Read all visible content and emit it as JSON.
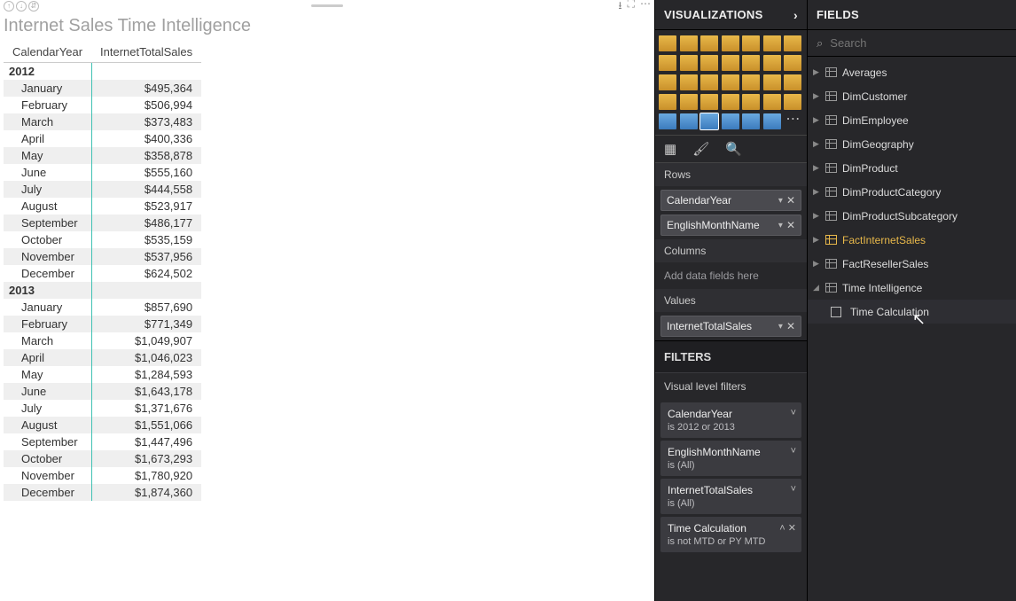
{
  "report": {
    "title": "Internet Sales Time Intelligence",
    "columns": [
      "CalendarYear",
      "InternetTotalSales"
    ],
    "groups": [
      {
        "year": "2012",
        "rows": [
          {
            "month": "January",
            "value": "$495,364"
          },
          {
            "month": "February",
            "value": "$506,994"
          },
          {
            "month": "March",
            "value": "$373,483"
          },
          {
            "month": "April",
            "value": "$400,336"
          },
          {
            "month": "May",
            "value": "$358,878"
          },
          {
            "month": "June",
            "value": "$555,160"
          },
          {
            "month": "July",
            "value": "$444,558"
          },
          {
            "month": "August",
            "value": "$523,917"
          },
          {
            "month": "September",
            "value": "$486,177"
          },
          {
            "month": "October",
            "value": "$535,159"
          },
          {
            "month": "November",
            "value": "$537,956"
          },
          {
            "month": "December",
            "value": "$624,502"
          }
        ]
      },
      {
        "year": "2013",
        "rows": [
          {
            "month": "January",
            "value": "$857,690"
          },
          {
            "month": "February",
            "value": "$771,349"
          },
          {
            "month": "March",
            "value": "$1,049,907"
          },
          {
            "month": "April",
            "value": "$1,046,023"
          },
          {
            "month": "May",
            "value": "$1,284,593"
          },
          {
            "month": "June",
            "value": "$1,643,178"
          },
          {
            "month": "July",
            "value": "$1,371,676"
          },
          {
            "month": "August",
            "value": "$1,551,066"
          },
          {
            "month": "September",
            "value": "$1,447,496"
          },
          {
            "month": "October",
            "value": "$1,673,293"
          },
          {
            "month": "November",
            "value": "$1,780,920"
          },
          {
            "month": "December",
            "value": "$1,874,360"
          }
        ]
      }
    ]
  },
  "viz": {
    "header": "VISUALIZATIONS",
    "rows_label": "Rows",
    "columns_label": "Columns",
    "values_label": "Values",
    "placeholder": "Add data fields here",
    "row_fields": [
      "CalendarYear",
      "EnglishMonthName"
    ],
    "value_fields": [
      "InternetTotalSales"
    ]
  },
  "filters": {
    "header": "FILTERS",
    "sub": "Visual level filters",
    "items": [
      {
        "title": "CalendarYear",
        "desc": "is 2012 or 2013",
        "ctrl": "˅"
      },
      {
        "title": "EnglishMonthName",
        "desc": "is (All)",
        "ctrl": "˅"
      },
      {
        "title": "InternetTotalSales",
        "desc": "is (All)",
        "ctrl": "˅"
      },
      {
        "title": "Time Calculation",
        "desc": "is not MTD or PY MTD",
        "ctrl": "˄ ✕"
      }
    ]
  },
  "fields": {
    "header": "FIELDS",
    "search_placeholder": "Search",
    "tables": [
      {
        "name": "Averages",
        "expanded": false,
        "active": false
      },
      {
        "name": "DimCustomer",
        "expanded": false,
        "active": false
      },
      {
        "name": "DimEmployee",
        "expanded": false,
        "active": false
      },
      {
        "name": "DimGeography",
        "expanded": false,
        "active": false
      },
      {
        "name": "DimProduct",
        "expanded": false,
        "active": false
      },
      {
        "name": "DimProductCategory",
        "expanded": false,
        "active": false
      },
      {
        "name": "DimProductSubcategory",
        "expanded": false,
        "active": false
      },
      {
        "name": "FactInternetSales",
        "expanded": false,
        "active": true
      },
      {
        "name": "FactResellerSales",
        "expanded": false,
        "active": false
      },
      {
        "name": "Time Intelligence",
        "expanded": true,
        "active": false,
        "children": [
          {
            "name": "Time Calculation",
            "checked": false
          }
        ]
      }
    ]
  }
}
